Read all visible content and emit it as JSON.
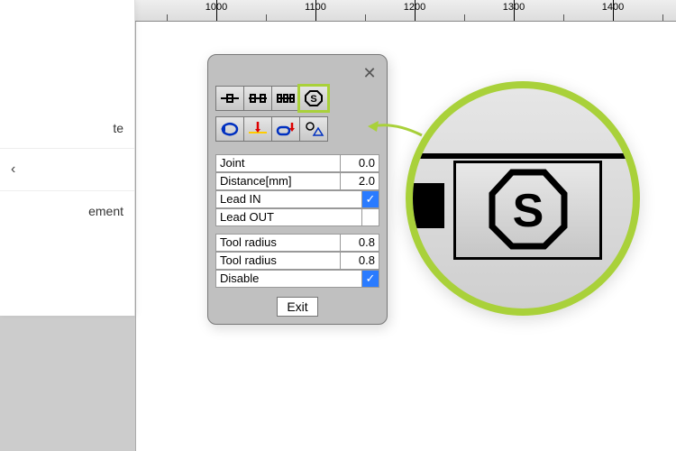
{
  "ruler": {
    "labels": [
      "1000",
      "1100",
      "1200",
      "1300",
      "1400"
    ],
    "positions": [
      90,
      200,
      310,
      420,
      530
    ]
  },
  "sidebar": {
    "items": [
      {
        "label": "te"
      },
      {
        "label": "",
        "chevron": true
      },
      {
        "label": "ement"
      }
    ]
  },
  "dialog": {
    "form": {
      "joint_label": "Joint",
      "joint_value": "0.0",
      "distance_label": "Distance[mm]",
      "distance_value": "2.0",
      "leadin_label": "Lead IN",
      "leadin_checked": true,
      "leadout_label": "Lead OUT",
      "leadout_checked": false,
      "toolradius1_label": "Tool radius",
      "toolradius1_value": "0.8",
      "toolradius2_label": "Tool radius",
      "toolradius2_value": "0.8",
      "disable_label": "Disable",
      "disable_checked": true
    },
    "exit_label": "Exit"
  },
  "icons": {
    "toolbar1": [
      "node-single",
      "node-double",
      "node-span",
      "stop-s"
    ],
    "toolbar2": [
      "cycle",
      "leadin-red",
      "leadout-blue",
      "shape-circle-triangle"
    ]
  }
}
